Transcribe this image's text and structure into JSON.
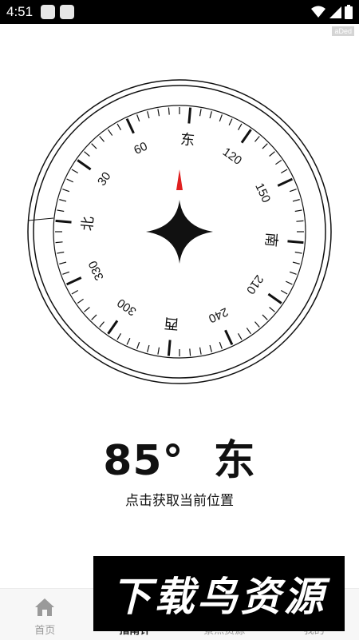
{
  "status_bar": {
    "time": "4:51",
    "icons": [
      "wifi-icon",
      "signal-icon",
      "battery-icon"
    ]
  },
  "ad_tag": "aDed",
  "compass": {
    "cardinals": [
      "东",
      "南",
      "西",
      "北"
    ],
    "degree_labels": [
      "30",
      "60",
      "120",
      "150",
      "210",
      "240",
      "300",
      "330"
    ],
    "heading_deg": 85,
    "needle_color": "#e02020"
  },
  "reading": {
    "degrees": "85°",
    "direction": "东"
  },
  "locate_label": "点击获取当前位置",
  "nav": {
    "items": [
      {
        "label": "首页",
        "icon": "home-icon"
      },
      {
        "label": "指南针",
        "icon": "compass-icon"
      },
      {
        "label": "景点资源",
        "icon": "map-icon"
      },
      {
        "label": "我的",
        "icon": "user-icon"
      }
    ]
  },
  "watermark": "下载鸟资源"
}
